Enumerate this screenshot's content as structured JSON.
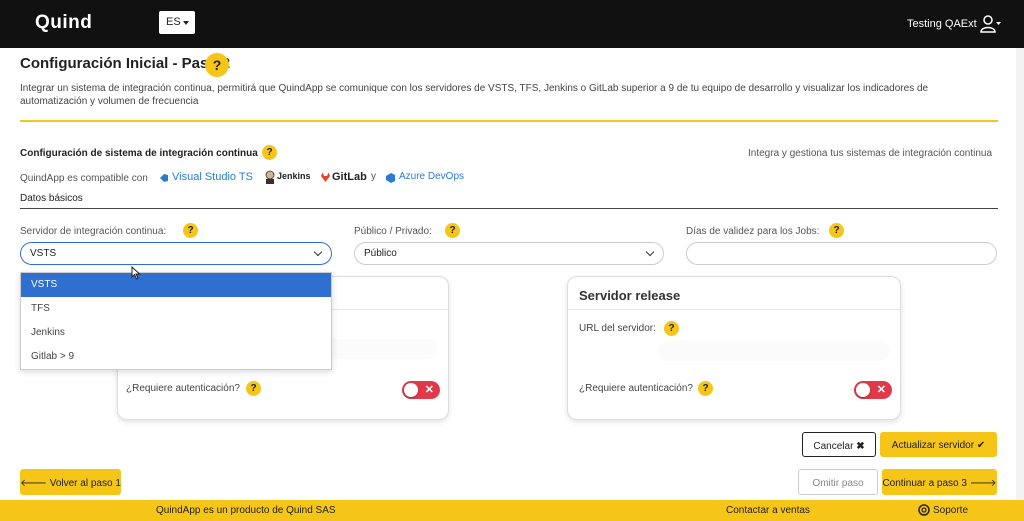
{
  "header": {
    "logo": "Quind",
    "language": "ES",
    "user_name": "Testing QAExt"
  },
  "page": {
    "title": "Configuración Inicial - Paso 2",
    "intro": "Integrar un sistema de integración continua, permitirá que QuindApp se comunique con los servidores de VSTS, TFS, Jenkins o GitLab superior a 9 de tu equipo de desarrollo y visualizar los indicadores de automatización y volumen de frecuencia",
    "help": "?"
  },
  "ci_section": {
    "title": "Configuración de sistema de integración continua",
    "subtitle_right": "Integra y gestiona tus sistemas de integración continua",
    "compatible_text": "QuindApp es compatible con",
    "brands": [
      "Visual Studio TS",
      "Jenkins",
      "GitLab",
      "y",
      "Azure DevOps"
    ],
    "datos_basicos": "Datos básicos"
  },
  "form": {
    "server_label": "Servidor de integración continua:",
    "server_value": "VSTS",
    "public_label": "Público / Privado:",
    "public_value": "Público",
    "days_label": "Días de validez para los Jobs:",
    "days_value": ""
  },
  "dropdown": {
    "options": [
      "VSTS",
      "TFS",
      "Jenkins",
      "Gitlab > 9"
    ],
    "selected": "VSTS"
  },
  "left_card": {
    "auth_label": "¿Requiere autenticación?"
  },
  "right_card": {
    "title": "Servidor release",
    "url_label": "URL del servidor:",
    "auth_label": "¿Requiere autenticación?"
  },
  "buttons": {
    "cancel": "Cancelar",
    "update": "Actualizar servidor",
    "back": "Volver al paso 1",
    "skip": "Omitir paso",
    "next": "Continuar a paso 3"
  },
  "footer": {
    "product": "QuindApp es un producto de Quind SAS",
    "sales": "Contactar a ventas",
    "support": "Soporte"
  },
  "colors": {
    "accent": "#f5c518",
    "topbar": "#111111",
    "select_focus": "#2f6fcf",
    "toggle_off": "#e03a4a"
  }
}
